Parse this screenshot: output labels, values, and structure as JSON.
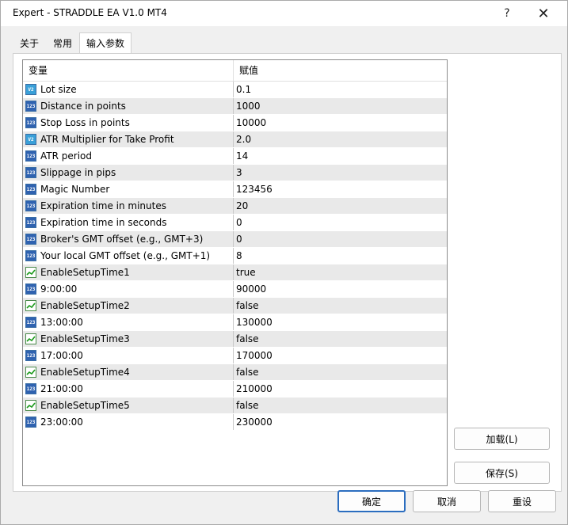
{
  "window": {
    "title": "Expert - STRADDLE EA V1.0 MT4",
    "help_glyph": "?",
    "close_glyph": "✕"
  },
  "tabs": [
    {
      "label": "关于"
    },
    {
      "label": "常用"
    },
    {
      "label": "输入参数",
      "active": true
    }
  ],
  "grid": {
    "header_var": "变量",
    "header_val": "赋值",
    "rows": [
      {
        "icon": "double-type-icon",
        "icon_text": "V2",
        "name": "Lot size",
        "value": "0.1"
      },
      {
        "icon": "int-type-icon",
        "icon_text": "123",
        "name": "Distance in points",
        "value": "1000"
      },
      {
        "icon": "int-type-icon",
        "icon_text": "123",
        "name": "Stop Loss in points",
        "value": "10000"
      },
      {
        "icon": "double-type-icon",
        "icon_text": "V2",
        "name": "ATR Multiplier for Take Profit",
        "value": "2.0"
      },
      {
        "icon": "int-type-icon",
        "icon_text": "123",
        "name": "ATR period",
        "value": "14"
      },
      {
        "icon": "int-type-icon",
        "icon_text": "123",
        "name": "Slippage in pips",
        "value": "3"
      },
      {
        "icon": "int-type-icon",
        "icon_text": "123",
        "name": "Magic Number",
        "value": "123456"
      },
      {
        "icon": "int-type-icon",
        "icon_text": "123",
        "name": "Expiration time in minutes",
        "value": "20"
      },
      {
        "icon": "int-type-icon",
        "icon_text": "123",
        "name": "Expiration time in seconds",
        "value": "0"
      },
      {
        "icon": "int-type-icon",
        "icon_text": "123",
        "name": "Broker's GMT offset (e.g., GMT+3)",
        "value": "0"
      },
      {
        "icon": "int-type-icon",
        "icon_text": "123",
        "name": "Your local GMT offset (e.g., GMT+1)",
        "value": "8"
      },
      {
        "icon": "bool-type-icon",
        "icon_text": "",
        "name": "EnableSetupTime1",
        "value": "true"
      },
      {
        "icon": "int-type-icon",
        "icon_text": "123",
        "name": "9:00:00",
        "value": "90000"
      },
      {
        "icon": "bool-type-icon",
        "icon_text": "",
        "name": "EnableSetupTime2",
        "value": "false"
      },
      {
        "icon": "int-type-icon",
        "icon_text": "123",
        "name": "13:00:00",
        "value": "130000"
      },
      {
        "icon": "bool-type-icon",
        "icon_text": "",
        "name": "EnableSetupTime3",
        "value": "false"
      },
      {
        "icon": "int-type-icon",
        "icon_text": "123",
        "name": "17:00:00",
        "value": "170000"
      },
      {
        "icon": "bool-type-icon",
        "icon_text": "",
        "name": "EnableSetupTime4",
        "value": "false"
      },
      {
        "icon": "int-type-icon",
        "icon_text": "123",
        "name": "21:00:00",
        "value": "210000"
      },
      {
        "icon": "bool-type-icon",
        "icon_text": "",
        "name": "EnableSetupTime5",
        "value": "false"
      },
      {
        "icon": "int-type-icon",
        "icon_text": "123",
        "name": "23:00:00",
        "value": "230000"
      }
    ]
  },
  "buttons": {
    "load": "加载(L)",
    "save": "保存(S)",
    "ok": "确定",
    "cancel": "取消",
    "reset": "重设"
  }
}
